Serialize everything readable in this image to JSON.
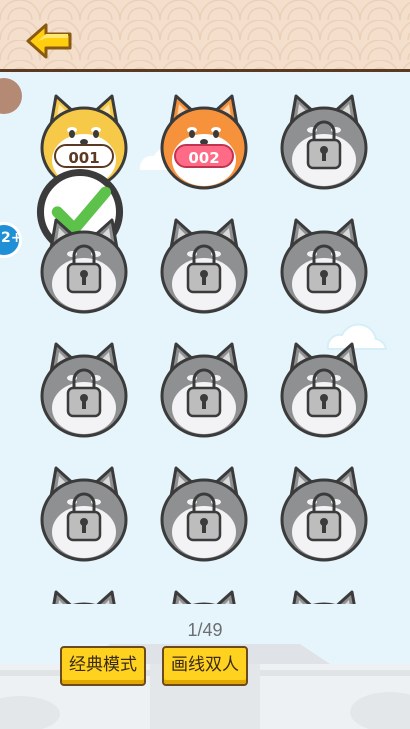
{
  "header": {
    "back_icon": "arrow-left-icon"
  },
  "levels": [
    {
      "label": "001",
      "state": "completed",
      "skin": "yellow"
    },
    {
      "label": "002",
      "state": "current",
      "skin": "orange"
    },
    {
      "label": "",
      "state": "locked"
    },
    {
      "label": "",
      "state": "locked"
    },
    {
      "label": "",
      "state": "locked"
    },
    {
      "label": "",
      "state": "locked"
    },
    {
      "label": "",
      "state": "locked"
    },
    {
      "label": "",
      "state": "locked"
    },
    {
      "label": "",
      "state": "locked"
    },
    {
      "label": "",
      "state": "locked"
    },
    {
      "label": "",
      "state": "locked"
    },
    {
      "label": "",
      "state": "locked"
    },
    {
      "label": "",
      "state": "locked"
    },
    {
      "label": "",
      "state": "locked"
    },
    {
      "label": "",
      "state": "locked"
    }
  ],
  "side_badge": {
    "text": "2+"
  },
  "footer": {
    "page_indicator": "1/49",
    "classic_mode_label": "经典模式",
    "draw_two_player_label": "画线双人"
  },
  "colors": {
    "topbar": "#f3dfcc",
    "background": "#e6f5fb",
    "button_yellow": "#ffd21f",
    "locked_gray": "#8e9092",
    "current_label": "#ff6a86"
  }
}
